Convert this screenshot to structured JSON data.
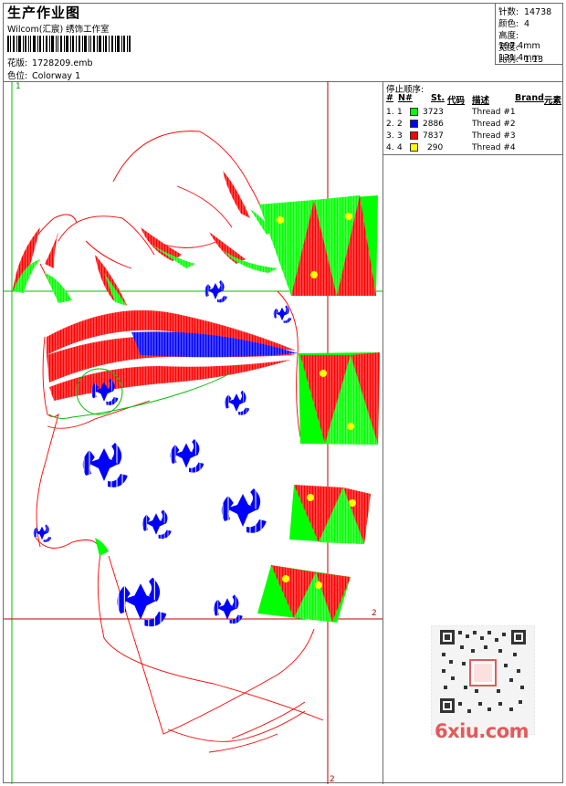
{
  "header": {
    "title": "生产作业图",
    "studio": "Wilcom(汇宸) 绣饰工作室",
    "design_label": "花版:",
    "design_value": "1728209.emb",
    "colorway_label": "色位:",
    "colorway_value": "Colorway 1"
  },
  "stats": [
    {
      "label": "针数:",
      "value": "14738"
    },
    {
      "label": "颜色:",
      "value": "4"
    },
    {
      "label": "高度:",
      "value": "197.4mm"
    },
    {
      "label": "宽度:",
      "value": "121.4mm"
    },
    {
      "label": "比例:",
      "value": "1.13"
    }
  ],
  "stop_sequence": {
    "title": "停止顺序:",
    "headers": {
      "num": "#",
      "n": "N#",
      "st": "St.",
      "code": "代码",
      "desc": "描述",
      "brand": "Brand",
      "element": "元素"
    },
    "rows": [
      {
        "num": "1.",
        "n": "1",
        "color": "#00ff00",
        "stitches": "3723",
        "desc": "Thread #1"
      },
      {
        "num": "2.",
        "n": "2",
        "color": "#0000ff",
        "stitches": "2886",
        "desc": "Thread #2"
      },
      {
        "num": "3.",
        "n": "3",
        "color": "#ff0000",
        "stitches": "7837",
        "desc": "Thread #3"
      },
      {
        "num": "4.",
        "n": "4",
        "color": "#ffff00",
        "stitches": "290",
        "desc": "Thread #4"
      }
    ]
  },
  "axes": {
    "label_1": "1",
    "label_2a": "2",
    "label_2b": "2"
  },
  "watermark": {
    "text": "6xiu.com"
  },
  "colors": {
    "green": "#00ff00",
    "blue": "#0000ff",
    "red": "#ff0000",
    "yellow": "#ffff00",
    "guide": "#c00000"
  }
}
